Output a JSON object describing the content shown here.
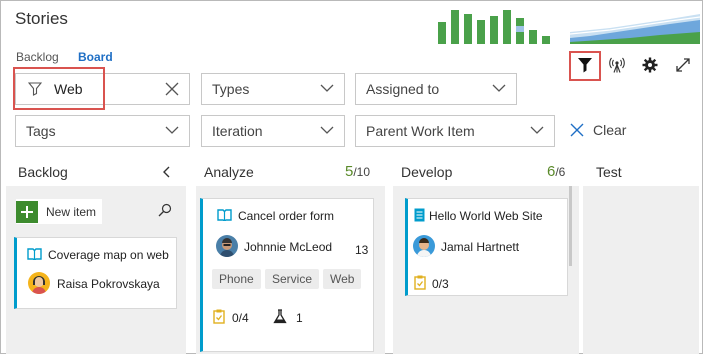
{
  "header": {
    "title": "Stories",
    "pivots": [
      {
        "label": "Backlog"
      },
      {
        "label": "Board"
      }
    ]
  },
  "filters": {
    "keyword_value": "Web",
    "types_label": "Types",
    "assigned_label": "Assigned to",
    "tags_label": "Tags",
    "iteration_label": "Iteration",
    "parent_label": "Parent Work Item",
    "clear_label": "Clear"
  },
  "columns": {
    "backlog": {
      "title": "Backlog",
      "new_item": "New item"
    },
    "analyze": {
      "title": "Analyze",
      "count": "5",
      "limit": "/10"
    },
    "develop": {
      "title": "Develop",
      "count": "6",
      "limit": "/6"
    },
    "test": {
      "title": "Test"
    }
  },
  "cards": {
    "backlog_card": {
      "title": "Coverage map on web",
      "assignee": "Raisa Pokrovskaya"
    },
    "analyze_card": {
      "title": "Cancel order form",
      "assignee": "Johnnie McLeod",
      "effort": "13",
      "tags": [
        "Phone",
        "Service",
        "Web"
      ],
      "tasks": "0/4",
      "tests": "1"
    },
    "develop_card": {
      "title": "Hello World Web Site",
      "assignee": "Jamal Hartnett",
      "tasks": "0/3"
    }
  },
  "colors": {
    "accent": "#009ccc",
    "highlight": "#d9534f",
    "add_green": "#3d8b2e",
    "wip_green": "#5a8a2a"
  },
  "icons": [
    "funnel-icon",
    "clear-x-icon",
    "chevron-down-icon",
    "filter-toggle-icon",
    "live-updates-icon",
    "gear-icon",
    "fullscreen-icon",
    "collapse-icon",
    "search-icon",
    "book-icon",
    "doc-icon",
    "task-icon",
    "flask-icon"
  ]
}
